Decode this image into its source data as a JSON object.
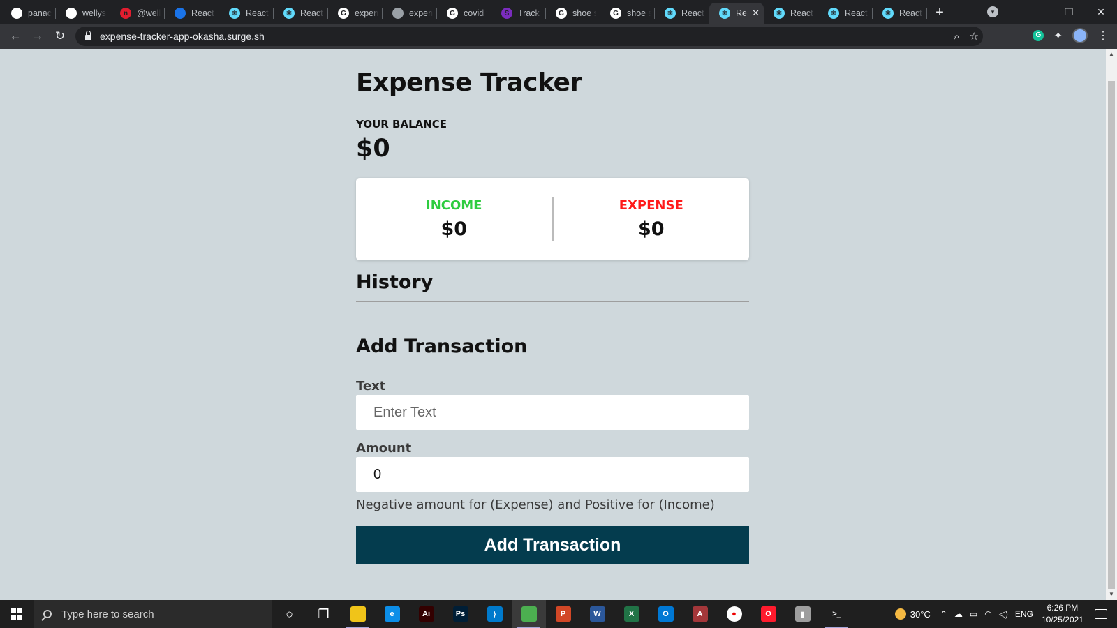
{
  "browser": {
    "tabs": [
      {
        "title": "panaclo",
        "favicon_color": "#ffffff",
        "favicon_glyph": ""
      },
      {
        "title": "wellysh",
        "favicon_color": "#ffffff",
        "favicon_glyph": ""
      },
      {
        "title": "@welly",
        "favicon_color": "#e11d2f",
        "favicon_glyph": "n"
      },
      {
        "title": "React G",
        "favicon_color": "#1a73e8",
        "favicon_glyph": ""
      },
      {
        "title": "React A",
        "favicon_color": "#61dafb",
        "favicon_glyph": "⚛"
      },
      {
        "title": "React A",
        "favicon_color": "#61dafb",
        "favicon_glyph": "⚛"
      },
      {
        "title": "expens",
        "favicon_color": "#ffffff",
        "favicon_glyph": "G"
      },
      {
        "title": "expens",
        "favicon_color": "#9aa0a6",
        "favicon_glyph": ""
      },
      {
        "title": "covid t",
        "favicon_color": "#ffffff",
        "favicon_glyph": "G"
      },
      {
        "title": "TrackTr",
        "favicon_color": "#7b2cbf",
        "favicon_glyph": "S"
      },
      {
        "title": "shoe st",
        "favicon_color": "#ffffff",
        "favicon_glyph": "G"
      },
      {
        "title": "shoe st",
        "favicon_color": "#ffffff",
        "favicon_glyph": "G"
      },
      {
        "title": "React A",
        "favicon_color": "#61dafb",
        "favicon_glyph": "⚛"
      },
      {
        "title": "Rea",
        "favicon_color": "#61dafb",
        "favicon_glyph": "⚛",
        "active": true
      },
      {
        "title": "React A",
        "favicon_color": "#61dafb",
        "favicon_glyph": "⚛"
      },
      {
        "title": "React A",
        "favicon_color": "#61dafb",
        "favicon_glyph": "⚛"
      },
      {
        "title": "React A",
        "favicon_color": "#61dafb",
        "favicon_glyph": "⚛"
      }
    ],
    "url": "expense-tracker-app-okasha.surge.sh",
    "icons": [
      "back-icon",
      "forward-icon",
      "reload-icon",
      "lock-icon",
      "zoom-icon",
      "star-icon",
      "grammarly-icon",
      "extensions-icon",
      "profile-avatar",
      "menu-icon"
    ]
  },
  "app": {
    "title": "Expense Tracker",
    "balance_label": "YOUR BALANCE",
    "balance_value": "$0",
    "income_label": "INCOME",
    "income_value": "$0",
    "expense_label": "EXPENSE",
    "expense_value": "$0",
    "history_heading": "History",
    "add_heading": "Add Transaction",
    "text_label": "Text",
    "text_placeholder": "Enter Text",
    "amount_label": "Amount",
    "amount_value": "0",
    "hint": "Negative amount for (Expense) and Positive for (Income)",
    "submit_label": "Add Transaction",
    "colors": {
      "income": "#2ecc40",
      "expense": "#ff1a1a",
      "button": "#043c4e",
      "background": "#cfd8dc"
    }
  },
  "taskbar": {
    "search_placeholder": "Type here to search",
    "apps": [
      {
        "name": "cortana",
        "glyph": "○",
        "color": "transparent"
      },
      {
        "name": "task-view",
        "glyph": "❐",
        "color": "transparent"
      },
      {
        "name": "file-explorer",
        "glyph": "",
        "color": "#f0c419",
        "running": true
      },
      {
        "name": "edge",
        "glyph": "e",
        "color": "#0c8ee8"
      },
      {
        "name": "illustrator",
        "glyph": "Ai",
        "color": "#330000"
      },
      {
        "name": "photoshop",
        "glyph": "Ps",
        "color": "#001e36"
      },
      {
        "name": "vscode",
        "glyph": "⟩",
        "color": "#007acc"
      },
      {
        "name": "chrome",
        "glyph": "",
        "color": "#4caf50",
        "running": true,
        "active": true
      },
      {
        "name": "powerpoint",
        "glyph": "P",
        "color": "#d24726"
      },
      {
        "name": "word",
        "glyph": "W",
        "color": "#2b579a"
      },
      {
        "name": "excel",
        "glyph": "X",
        "color": "#217346"
      },
      {
        "name": "outlook",
        "glyph": "O",
        "color": "#0078d4"
      },
      {
        "name": "access",
        "glyph": "A",
        "color": "#a4373a"
      },
      {
        "name": "recorder",
        "glyph": "●",
        "color": "#ffffff"
      },
      {
        "name": "opera",
        "glyph": "O",
        "color": "#ff1b2d"
      },
      {
        "name": "usb-app",
        "glyph": "▮",
        "color": "#9e9e9e"
      },
      {
        "name": "terminal",
        "glyph": ">_",
        "color": "#1f1f1f",
        "running": true
      }
    ],
    "temperature": "30°C",
    "language": "ENG",
    "time": "6:26 PM",
    "date": "10/25/2021"
  }
}
